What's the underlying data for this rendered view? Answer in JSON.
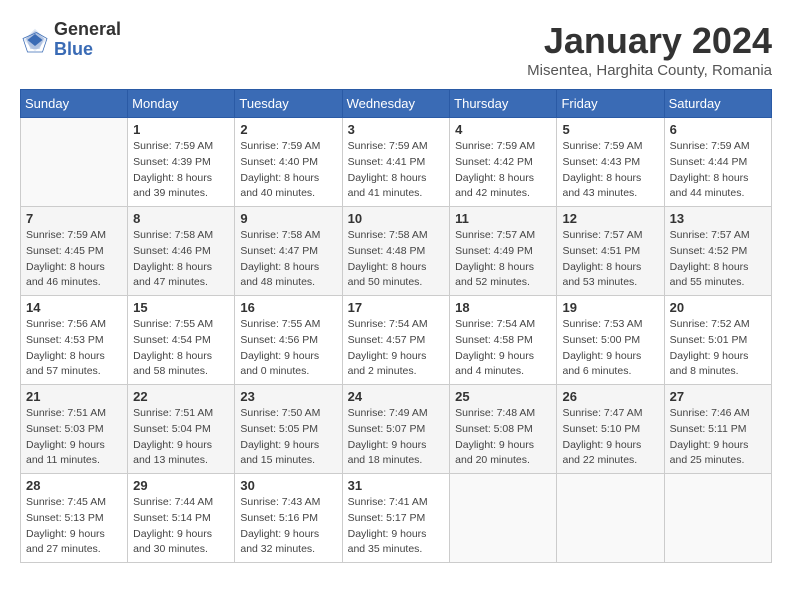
{
  "header": {
    "logo_general": "General",
    "logo_blue": "Blue",
    "month_title": "January 2024",
    "location": "Misentea, Harghita County, Romania"
  },
  "days_of_week": [
    "Sunday",
    "Monday",
    "Tuesday",
    "Wednesday",
    "Thursday",
    "Friday",
    "Saturday"
  ],
  "weeks": [
    [
      {
        "day": "",
        "sunrise": "",
        "sunset": "",
        "daylight": ""
      },
      {
        "day": "1",
        "sunrise": "Sunrise: 7:59 AM",
        "sunset": "Sunset: 4:39 PM",
        "daylight": "Daylight: 8 hours and 39 minutes."
      },
      {
        "day": "2",
        "sunrise": "Sunrise: 7:59 AM",
        "sunset": "Sunset: 4:40 PM",
        "daylight": "Daylight: 8 hours and 40 minutes."
      },
      {
        "day": "3",
        "sunrise": "Sunrise: 7:59 AM",
        "sunset": "Sunset: 4:41 PM",
        "daylight": "Daylight: 8 hours and 41 minutes."
      },
      {
        "day": "4",
        "sunrise": "Sunrise: 7:59 AM",
        "sunset": "Sunset: 4:42 PM",
        "daylight": "Daylight: 8 hours and 42 minutes."
      },
      {
        "day": "5",
        "sunrise": "Sunrise: 7:59 AM",
        "sunset": "Sunset: 4:43 PM",
        "daylight": "Daylight: 8 hours and 43 minutes."
      },
      {
        "day": "6",
        "sunrise": "Sunrise: 7:59 AM",
        "sunset": "Sunset: 4:44 PM",
        "daylight": "Daylight: 8 hours and 44 minutes."
      }
    ],
    [
      {
        "day": "7",
        "sunrise": "Sunrise: 7:59 AM",
        "sunset": "Sunset: 4:45 PM",
        "daylight": "Daylight: 8 hours and 46 minutes."
      },
      {
        "day": "8",
        "sunrise": "Sunrise: 7:58 AM",
        "sunset": "Sunset: 4:46 PM",
        "daylight": "Daylight: 8 hours and 47 minutes."
      },
      {
        "day": "9",
        "sunrise": "Sunrise: 7:58 AM",
        "sunset": "Sunset: 4:47 PM",
        "daylight": "Daylight: 8 hours and 48 minutes."
      },
      {
        "day": "10",
        "sunrise": "Sunrise: 7:58 AM",
        "sunset": "Sunset: 4:48 PM",
        "daylight": "Daylight: 8 hours and 50 minutes."
      },
      {
        "day": "11",
        "sunrise": "Sunrise: 7:57 AM",
        "sunset": "Sunset: 4:49 PM",
        "daylight": "Daylight: 8 hours and 52 minutes."
      },
      {
        "day": "12",
        "sunrise": "Sunrise: 7:57 AM",
        "sunset": "Sunset: 4:51 PM",
        "daylight": "Daylight: 8 hours and 53 minutes."
      },
      {
        "day": "13",
        "sunrise": "Sunrise: 7:57 AM",
        "sunset": "Sunset: 4:52 PM",
        "daylight": "Daylight: 8 hours and 55 minutes."
      }
    ],
    [
      {
        "day": "14",
        "sunrise": "Sunrise: 7:56 AM",
        "sunset": "Sunset: 4:53 PM",
        "daylight": "Daylight: 8 hours and 57 minutes."
      },
      {
        "day": "15",
        "sunrise": "Sunrise: 7:55 AM",
        "sunset": "Sunset: 4:54 PM",
        "daylight": "Daylight: 8 hours and 58 minutes."
      },
      {
        "day": "16",
        "sunrise": "Sunrise: 7:55 AM",
        "sunset": "Sunset: 4:56 PM",
        "daylight": "Daylight: 9 hours and 0 minutes."
      },
      {
        "day": "17",
        "sunrise": "Sunrise: 7:54 AM",
        "sunset": "Sunset: 4:57 PM",
        "daylight": "Daylight: 9 hours and 2 minutes."
      },
      {
        "day": "18",
        "sunrise": "Sunrise: 7:54 AM",
        "sunset": "Sunset: 4:58 PM",
        "daylight": "Daylight: 9 hours and 4 minutes."
      },
      {
        "day": "19",
        "sunrise": "Sunrise: 7:53 AM",
        "sunset": "Sunset: 5:00 PM",
        "daylight": "Daylight: 9 hours and 6 minutes."
      },
      {
        "day": "20",
        "sunrise": "Sunrise: 7:52 AM",
        "sunset": "Sunset: 5:01 PM",
        "daylight": "Daylight: 9 hours and 8 minutes."
      }
    ],
    [
      {
        "day": "21",
        "sunrise": "Sunrise: 7:51 AM",
        "sunset": "Sunset: 5:03 PM",
        "daylight": "Daylight: 9 hours and 11 minutes."
      },
      {
        "day": "22",
        "sunrise": "Sunrise: 7:51 AM",
        "sunset": "Sunset: 5:04 PM",
        "daylight": "Daylight: 9 hours and 13 minutes."
      },
      {
        "day": "23",
        "sunrise": "Sunrise: 7:50 AM",
        "sunset": "Sunset: 5:05 PM",
        "daylight": "Daylight: 9 hours and 15 minutes."
      },
      {
        "day": "24",
        "sunrise": "Sunrise: 7:49 AM",
        "sunset": "Sunset: 5:07 PM",
        "daylight": "Daylight: 9 hours and 18 minutes."
      },
      {
        "day": "25",
        "sunrise": "Sunrise: 7:48 AM",
        "sunset": "Sunset: 5:08 PM",
        "daylight": "Daylight: 9 hours and 20 minutes."
      },
      {
        "day": "26",
        "sunrise": "Sunrise: 7:47 AM",
        "sunset": "Sunset: 5:10 PM",
        "daylight": "Daylight: 9 hours and 22 minutes."
      },
      {
        "day": "27",
        "sunrise": "Sunrise: 7:46 AM",
        "sunset": "Sunset: 5:11 PM",
        "daylight": "Daylight: 9 hours and 25 minutes."
      }
    ],
    [
      {
        "day": "28",
        "sunrise": "Sunrise: 7:45 AM",
        "sunset": "Sunset: 5:13 PM",
        "daylight": "Daylight: 9 hours and 27 minutes."
      },
      {
        "day": "29",
        "sunrise": "Sunrise: 7:44 AM",
        "sunset": "Sunset: 5:14 PM",
        "daylight": "Daylight: 9 hours and 30 minutes."
      },
      {
        "day": "30",
        "sunrise": "Sunrise: 7:43 AM",
        "sunset": "Sunset: 5:16 PM",
        "daylight": "Daylight: 9 hours and 32 minutes."
      },
      {
        "day": "31",
        "sunrise": "Sunrise: 7:41 AM",
        "sunset": "Sunset: 5:17 PM",
        "daylight": "Daylight: 9 hours and 35 minutes."
      },
      {
        "day": "",
        "sunrise": "",
        "sunset": "",
        "daylight": ""
      },
      {
        "day": "",
        "sunrise": "",
        "sunset": "",
        "daylight": ""
      },
      {
        "day": "",
        "sunrise": "",
        "sunset": "",
        "daylight": ""
      }
    ]
  ]
}
